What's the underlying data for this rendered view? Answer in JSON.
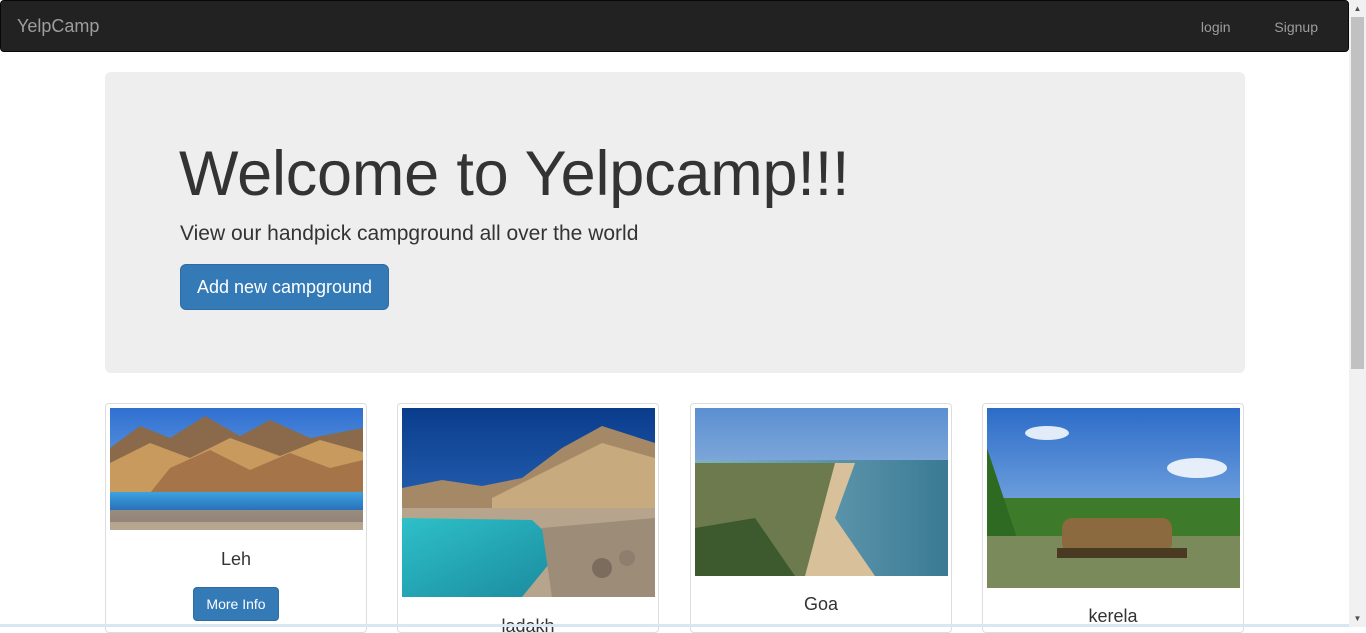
{
  "navbar": {
    "brand": "YelpCamp",
    "links": [
      "login",
      "Signup"
    ]
  },
  "jumbotron": {
    "title": "Welcome to Yelpcamp!!!",
    "subtitle": "View our handpick campground all over the world",
    "button_label": "Add new campground"
  },
  "campgrounds": [
    {
      "name": "Leh",
      "button_label": "More Info",
      "image": "mountain-lake-image"
    },
    {
      "name": "ladakh",
      "image": "river-valley-image"
    },
    {
      "name": "Goa",
      "image": "beach-coast-image"
    },
    {
      "name": "kerela",
      "image": "houseboat-backwater-image"
    }
  ],
  "colors": {
    "navbar_bg": "#222222",
    "primary": "#337ab7",
    "jumbotron_bg": "#eeeeee"
  }
}
